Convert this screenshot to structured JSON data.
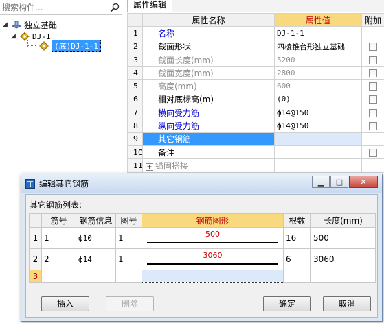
{
  "search": {
    "placeholder": "搜索构件..."
  },
  "tree": {
    "root": "独立基础",
    "child": "DJ-1",
    "leaf": "(底)DJ-1-1"
  },
  "props": {
    "tab": "属性编辑",
    "headers": [
      "属性名称",
      "属性值",
      "附加"
    ],
    "rows": [
      {
        "n": "1",
        "name": "名称",
        "value": "DJ-1-1",
        "style": "blue",
        "check": false
      },
      {
        "n": "2",
        "name": "截面形状",
        "value": "四棱锥台形独立基础",
        "style": "normal",
        "check": true
      },
      {
        "n": "3",
        "name": "截面长度(mm)",
        "value": "5200",
        "style": "gray",
        "check": true
      },
      {
        "n": "4",
        "name": "截面宽度(mm)",
        "value": "2800",
        "style": "gray",
        "check": true
      },
      {
        "n": "5",
        "name": "高度(mm)",
        "value": "600",
        "style": "gray",
        "check": true
      },
      {
        "n": "6",
        "name": "相对底标高(m)",
        "value": "(0)",
        "style": "normal",
        "check": true
      },
      {
        "n": "7",
        "name": "横向受力筋",
        "value": "ф14@150",
        "style": "blue",
        "check": true
      },
      {
        "n": "8",
        "name": "纵向受力筋",
        "value": "ф14@150",
        "style": "blue",
        "check": true
      },
      {
        "n": "9",
        "name": "其它钢筋",
        "value": "",
        "style": "selected",
        "check": false
      },
      {
        "n": "10",
        "name": "备注",
        "value": "",
        "style": "normal",
        "check": true
      },
      {
        "n": "11",
        "name": "锚固搭接",
        "value": "",
        "style": "group",
        "check": false
      }
    ]
  },
  "dialog": {
    "title": "编辑其它钢筋",
    "list_label": "其它钢筋列表:",
    "headers": [
      "筋号",
      "钢筋信息",
      "图号",
      "钢筋图形",
      "根数",
      "长度(mm)"
    ],
    "rows": [
      {
        "n": "1",
        "id": "1",
        "info": "ф10",
        "fig": "1",
        "len_label": "500",
        "count": "16",
        "length": "500"
      },
      {
        "n": "2",
        "id": "2",
        "info": "ф14",
        "fig": "1",
        "len_label": "3060",
        "count": "6",
        "length": "3060"
      }
    ],
    "new_row": "3",
    "buttons": {
      "insert": "插入",
      "delete": "删除",
      "ok": "确定",
      "cancel": "取消"
    }
  },
  "colors": {
    "selection": "#3399ff",
    "header_highlight": "#f9d97e",
    "link_blue": "#0000cc",
    "dim_red": "#cc0000"
  }
}
